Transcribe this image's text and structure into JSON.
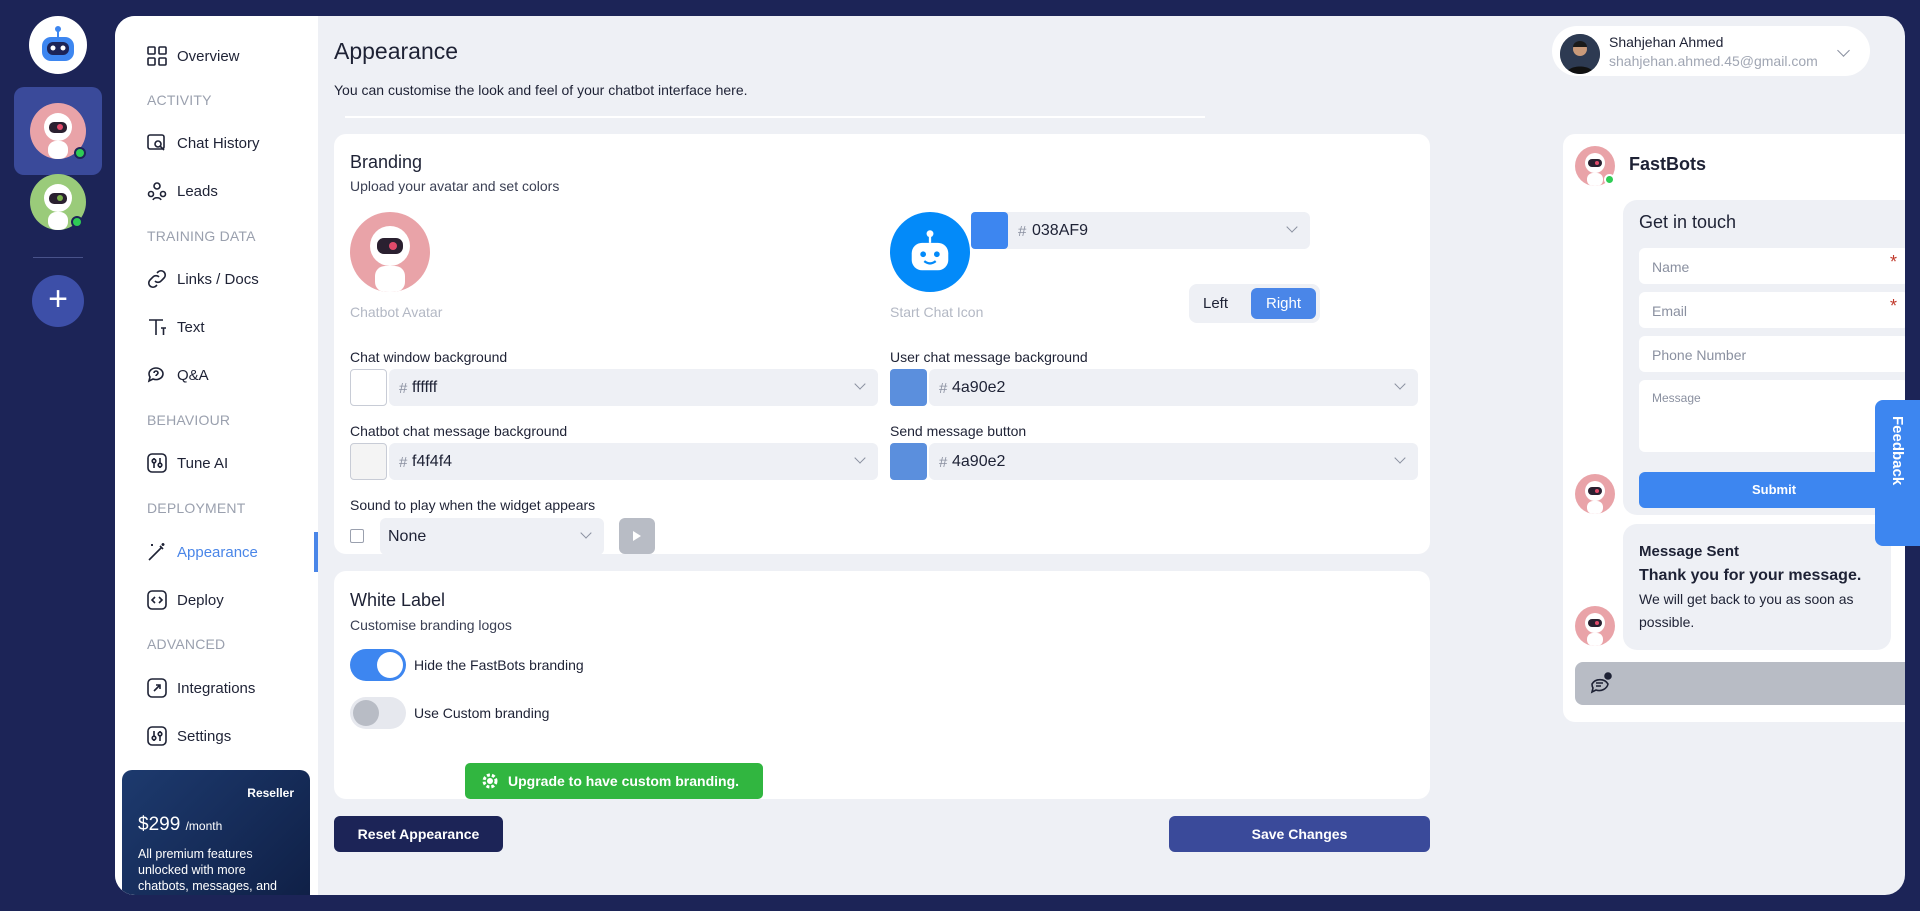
{
  "sidebar": {
    "overview": "Overview",
    "sec_activity": "ACTIVITY",
    "chat_history": "Chat History",
    "leads": "Leads",
    "sec_training": "TRAINING DATA",
    "links_docs": "Links / Docs",
    "text": "Text",
    "qa": "Q&A",
    "sec_behaviour": "BEHAVIOUR",
    "tune_ai": "Tune AI",
    "sec_deployment": "DEPLOYMENT",
    "appearance": "Appearance",
    "deploy": "Deploy",
    "sec_advanced": "ADVANCED",
    "integrations": "Integrations",
    "settings": "Settings"
  },
  "promo": {
    "tag": "Reseller",
    "price": "$299",
    "period": "/month",
    "desc": "All premium features unlocked with more chatbots, messages, and"
  },
  "header": {
    "title": "Appearance",
    "subtitle": "You can customise the look and feel of your chatbot interface here."
  },
  "user": {
    "name": "Shahjehan Ahmed",
    "email": "shahjehan.ahmed.45@gmail.com"
  },
  "branding": {
    "title": "Branding",
    "subtitle": "Upload your avatar and set colors",
    "avatar_caption": "Chatbot Avatar",
    "start_icon_caption": "Start Chat Icon",
    "icon_color": "038AF9",
    "position_left": "Left",
    "position_right": "Right",
    "chat_bg_label": "Chat window background",
    "chat_bg_value": "ffffff",
    "user_msg_label": "User chat message background",
    "user_msg_value": "4a90e2",
    "bot_msg_label": "Chatbot chat message background",
    "bot_msg_value": "f4f4f4",
    "send_btn_label": "Send message button",
    "send_btn_value": "4a90e2",
    "sound_label": "Sound to play when the widget appears",
    "sound_value": "None"
  },
  "white_label": {
    "title": "White Label",
    "subtitle": "Customise branding logos",
    "hide_branding": "Hide the FastBots branding",
    "hide_branding_on": true,
    "custom_branding": "Use Custom branding",
    "custom_branding_on": false,
    "upgrade": "Upgrade to have custom branding."
  },
  "actions": {
    "reset": "Reset Appearance",
    "save": "Save Changes"
  },
  "preview": {
    "bot_name": "FastBots",
    "form_title": "Get in touch",
    "name_ph": "Name",
    "email_ph": "Email",
    "phone_ph": "Phone Number",
    "message_ph": "Message",
    "submit": "Submit",
    "sent_title": "Message Sent",
    "sent_thanks": "Thank you for your message.",
    "sent_body": "We will get back to you as soon as possible.",
    "feedback": "Feedback"
  },
  "colors": {
    "accent": "#4a86e8",
    "icon_color": "#038AF9",
    "user_msg": "#4a90e2",
    "bot_msg": "#f4f4f4",
    "green": "#31b640",
    "navy": "#1c2457"
  }
}
